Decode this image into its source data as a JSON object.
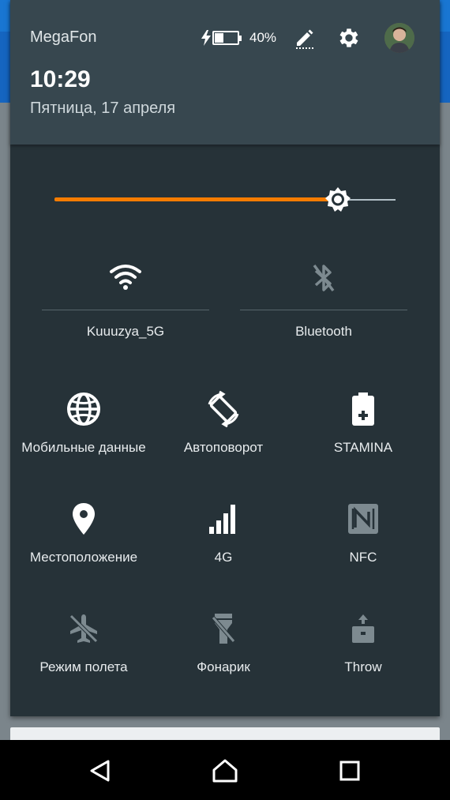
{
  "status": {
    "carrier": "MegaFon",
    "battery_percent_text": "40%",
    "battery_level": 0.4,
    "icons": [
      "charging-bolt-icon",
      "battery-icon",
      "edit-icon",
      "settings-icon",
      "avatar"
    ]
  },
  "clock": {
    "time": "10:29",
    "date": "Пятница, 17 апреля"
  },
  "brightness": {
    "level": 0.83,
    "accent": "#f57c00"
  },
  "wide_tiles": [
    {
      "label": "Kuuuzya_5G",
      "icon": "wifi-icon",
      "active": true
    },
    {
      "label": "Bluetooth",
      "icon": "bluetooth-off-icon",
      "active": false
    }
  ],
  "tiles": [
    {
      "label": "Мобильные данные",
      "icon": "globe-icon",
      "active": true
    },
    {
      "label": "Автоповорот",
      "icon": "auto-rotate-icon",
      "active": true
    },
    {
      "label": "STAMINA",
      "icon": "battery-plus-icon",
      "active": true
    },
    {
      "label": "Местоположение",
      "icon": "location-pin-icon",
      "active": true
    },
    {
      "label": "4G",
      "icon": "signal-icon",
      "active": true
    },
    {
      "label": "NFC",
      "icon": "nfc-icon",
      "active": false
    },
    {
      "label": "Режим полета",
      "icon": "airplane-off-icon",
      "active": false
    },
    {
      "label": "Фонарик",
      "icon": "flashlight-off-icon",
      "active": false
    },
    {
      "label": "Throw",
      "icon": "throw-icon",
      "active": false
    }
  ],
  "navigation": {
    "icons": [
      "back-icon",
      "home-icon",
      "recents-icon"
    ]
  },
  "colors": {
    "panel": "#263238",
    "header": "#37474f",
    "active_icon": "#ffffff",
    "inactive_icon": "#7d8a90"
  }
}
